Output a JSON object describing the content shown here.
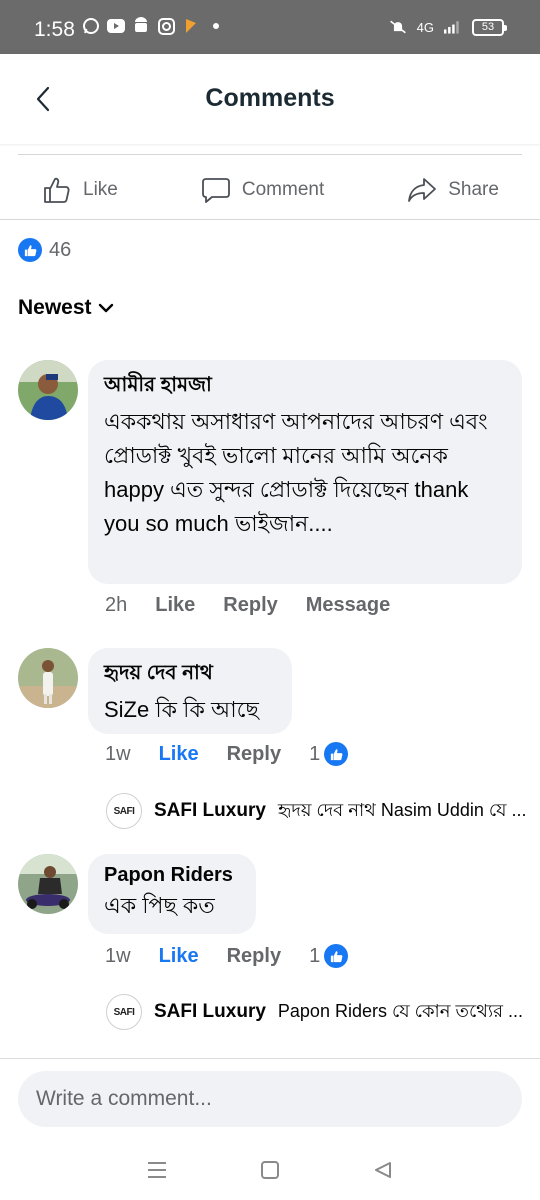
{
  "status_bar": {
    "time": "1:58",
    "network": "4G",
    "battery": "53"
  },
  "header": {
    "title": "Comments"
  },
  "actions": {
    "like": "Like",
    "comment": "Comment",
    "share": "Share"
  },
  "reactions": {
    "count": "46"
  },
  "sort": {
    "label": "Newest"
  },
  "comments": [
    {
      "author": "আমীর হামজা",
      "text": "এককথায় অসাধারণ আপনাদের আচরণ এবং প্রোডাক্ট খুবই ভালো মানের আমি অনেক happy এত সুন্দর প্রোডাক্ট দিয়েছেন thank you so much ভাইজান....",
      "time": "2h",
      "like": "Like",
      "reply": "Reply",
      "message": "Message"
    },
    {
      "author": "হৃদয় দেব নাথ",
      "text": "SiZe কি কি আছে",
      "time": "1w",
      "like": "Like",
      "reply": "Reply",
      "react_count": "1",
      "reply_preview": {
        "logo": "SAFI",
        "author": "SAFI Luxury",
        "text": "হৃদয় দেব নাথ Nasim Uddin যে ..."
      }
    },
    {
      "author": "Papon Riders",
      "text": "এক পিছ কত",
      "time": "1w",
      "like": "Like",
      "reply": "Reply",
      "react_count": "1",
      "reply_preview": {
        "logo": "SAFI",
        "author": "SAFI Luxury",
        "text": "Papon Riders যে কোন তথ্যের ..."
      }
    }
  ],
  "composer": {
    "placeholder": "Write a comment..."
  },
  "colors": {
    "accent": "#1877f2",
    "bubble": "#f0f2f5",
    "secondary_text": "#65676b",
    "status_bar": "#6b6b6b"
  }
}
